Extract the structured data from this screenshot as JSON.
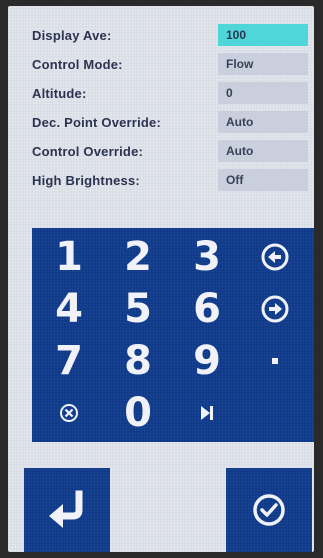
{
  "settings": [
    {
      "label": "Display Ave:",
      "value": "100",
      "active": true
    },
    {
      "label": "Control Mode:",
      "value": "Flow",
      "active": false
    },
    {
      "label": "Altitude:",
      "value": "0",
      "active": false
    },
    {
      "label": "Dec. Point Override:",
      "value": "Auto",
      "active": false
    },
    {
      "label": "Control Override:",
      "value": "Auto",
      "active": false
    },
    {
      "label": "High Brightness:",
      "value": "Off",
      "active": false
    }
  ],
  "keypad": {
    "k1": "1",
    "k2": "2",
    "k3": "3",
    "k4": "4",
    "k5": "5",
    "k6": "6",
    "k7": "7",
    "k8": "8",
    "k9": "9",
    "k0": "0",
    "dot": ".",
    "icons": {
      "left": "arrow-left-circle-icon",
      "right": "arrow-right-circle-icon",
      "clear": "clear-circle-icon",
      "skip": "skip-forward-icon"
    }
  },
  "buttons": {
    "enter_icon": "enter-return-icon",
    "confirm_icon": "check-circle-icon"
  },
  "colors": {
    "screen_bg": "#d9dde6",
    "keypad_bg": "#0f3a8a",
    "active_value": "#4fd6d8",
    "label_text": "#2b3350"
  }
}
